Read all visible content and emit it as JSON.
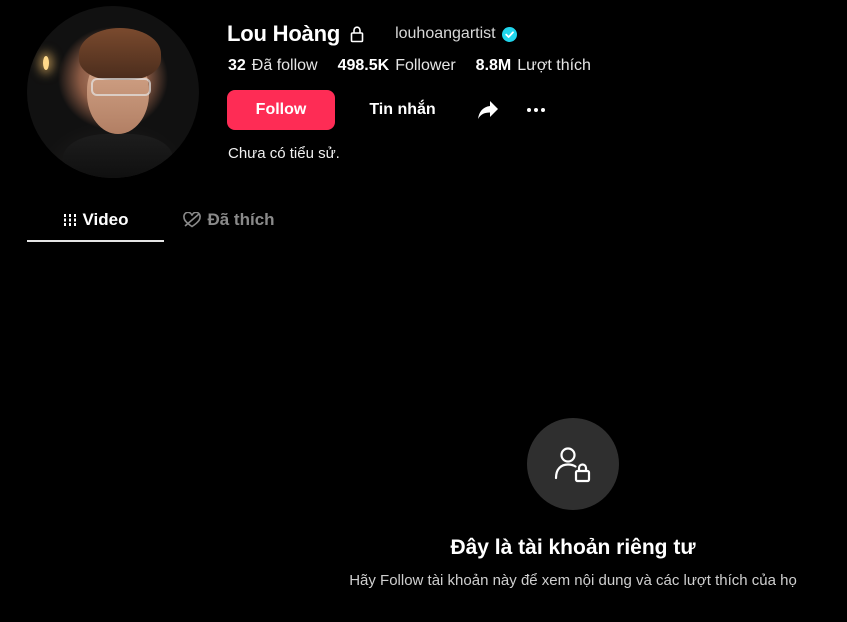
{
  "profile": {
    "display_name": "Lou Hoàng",
    "username": "louhoangartist",
    "bio": "Chưa có tiểu sử."
  },
  "stats": {
    "following": {
      "count": "32",
      "label": "Đã follow"
    },
    "followers": {
      "count": "498.5K",
      "label": "Follower"
    },
    "likes": {
      "count": "8.8M",
      "label": "Lượt thích"
    }
  },
  "actions": {
    "follow_label": "Follow",
    "message_label": "Tin nhắn"
  },
  "tabs": [
    {
      "label": "Video",
      "icon": "grid-lines-icon",
      "active": true
    },
    {
      "label": "Đã thích",
      "icon": "heart-hidden-icon",
      "active": false
    }
  ],
  "private_notice": {
    "title": "Đây là tài khoản riêng tư",
    "description": "Hãy Follow tài khoản này để xem nội dung và các lượt thích của họ",
    "icon": "user-lock-icon"
  },
  "colors": {
    "background": "#000000",
    "follow_button": "#fe2c55",
    "verified_badge": "#20d5ec",
    "private_circle": "#2f2f2f"
  }
}
